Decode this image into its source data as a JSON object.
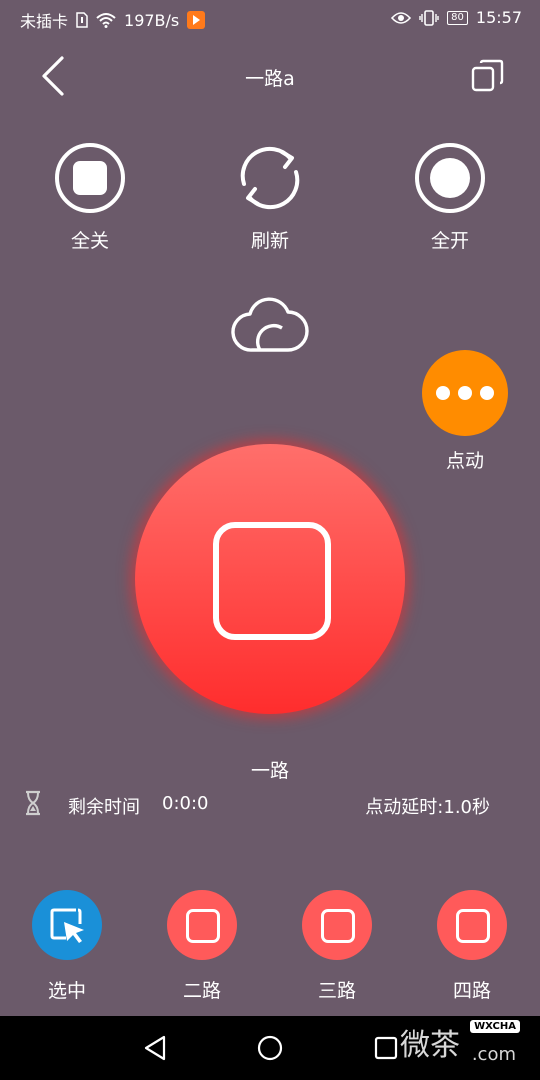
{
  "status_bar": {
    "carrier": "未插卡",
    "speed": "197B/s",
    "battery": "80",
    "time": "15:57"
  },
  "header": {
    "title": "一路a"
  },
  "top_actions": [
    {
      "label": "全关",
      "icon": "stop-circle-icon"
    },
    {
      "label": "刷新",
      "icon": "refresh-icon"
    },
    {
      "label": "全开",
      "icon": "record-circle-icon"
    }
  ],
  "jog": {
    "label": "点动",
    "color": "#ff8c00"
  },
  "main": {
    "channel_name": "一路",
    "remaining_label": "剩余时间",
    "remaining_value": "0:0:0",
    "delay_text": "点动延时:1.0秒",
    "power_color": "#ff3b3b"
  },
  "tabs": [
    {
      "label": "选中",
      "selected": true,
      "icon": "cursor-select-icon"
    },
    {
      "label": "二路",
      "selected": false,
      "icon": "square-icon"
    },
    {
      "label": "三路",
      "selected": false,
      "icon": "square-icon"
    },
    {
      "label": "四路",
      "selected": false,
      "icon": "square-icon"
    }
  ],
  "watermark": {
    "text": "微茶",
    "badge": "WXCHA",
    "suffix": ".com"
  },
  "colors": {
    "background": "#6b5a6a",
    "selected_tab": "#1a90d8",
    "channel_tab": "#ff5a5a"
  }
}
